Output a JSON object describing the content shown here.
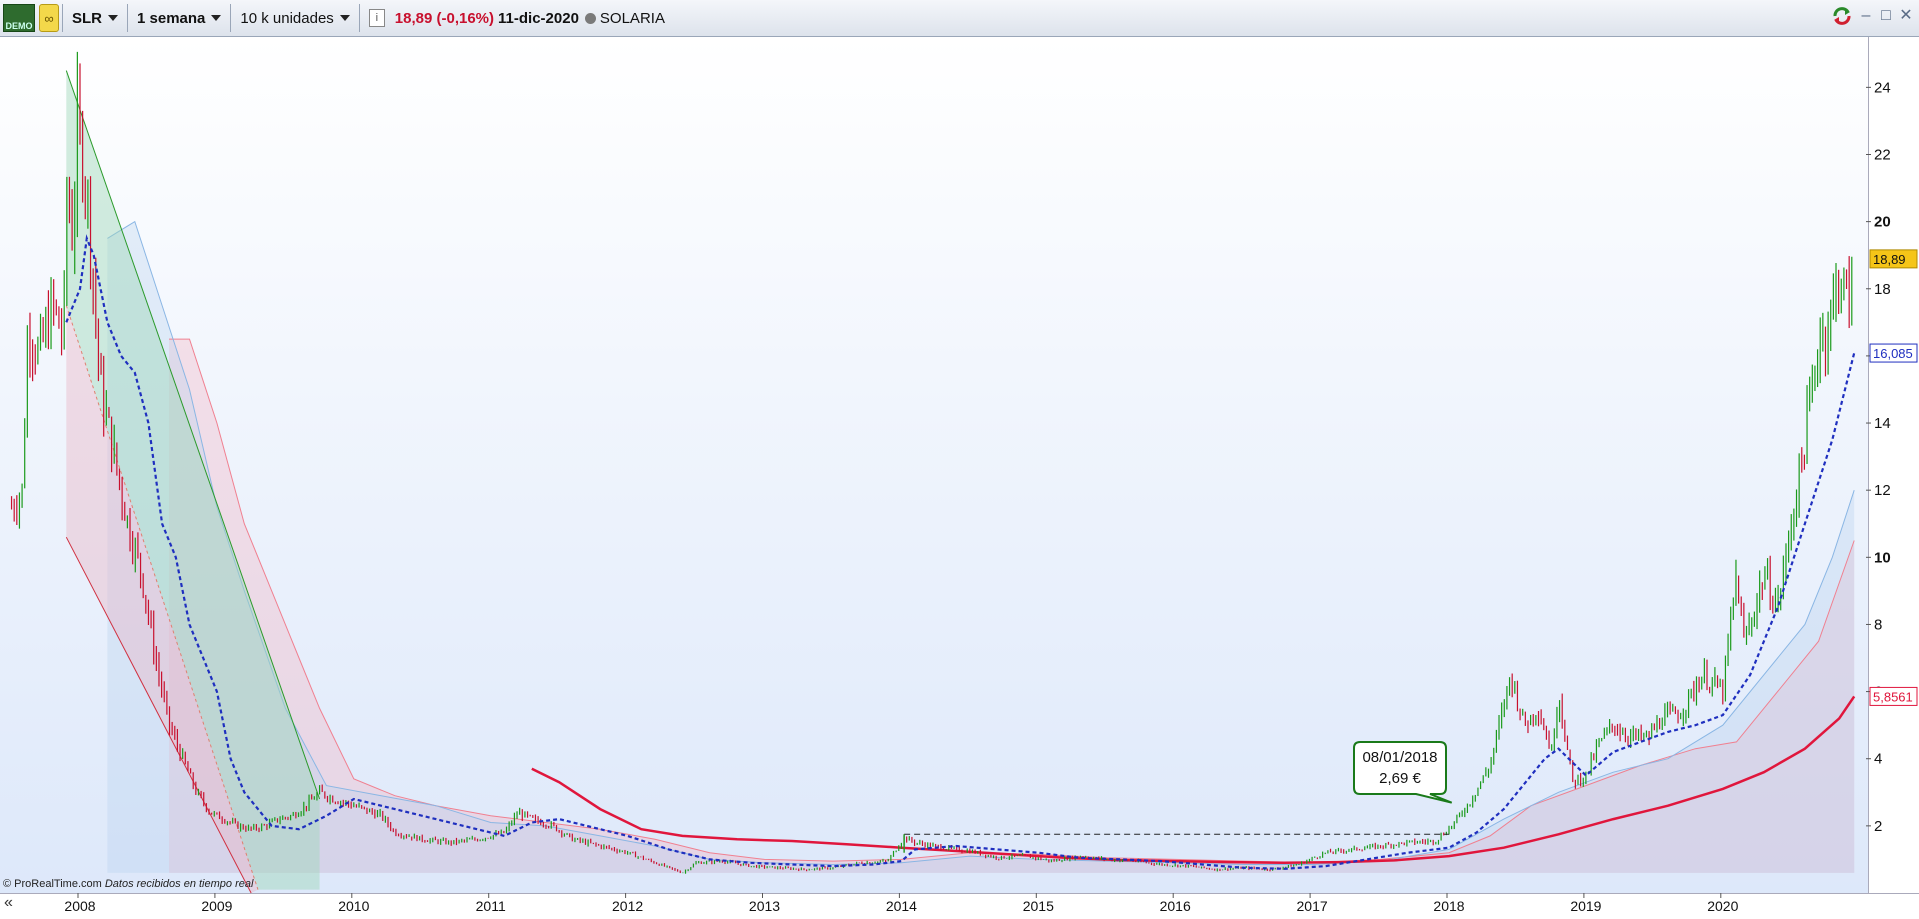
{
  "toolbar": {
    "demo_label": "DEMO",
    "ticker": "SLR",
    "timeframe": "1 semana",
    "units": "10 k unidades",
    "price_change": "18,89 (-0,16%)",
    "date": "11-dic-2020",
    "instrument_name": "SOLARIA"
  },
  "footer": {
    "copyright": "© ProRealTime.com",
    "realtime": "Datos recibidos en tiempo real",
    "nav_arrows": "«"
  },
  "annotation": {
    "date": "08/01/2018",
    "price": "2,69 €"
  },
  "colors": {
    "bull": "#1a9a1a",
    "bear": "#c8102e",
    "ma_dashed": "#1f2fbf",
    "ma_long": "#e0163c",
    "cloud_red": "#f4b3c0",
    "cloud_blue": "#b6d2ef"
  },
  "chart_data": {
    "type": "line",
    "title": "",
    "xlabel": "",
    "ylabel": "",
    "x_ticks": [
      "2008",
      "2009",
      "2010",
      "2011",
      "2012",
      "2013",
      "2014",
      "2015",
      "2016",
      "2017",
      "2018",
      "2019",
      "2020"
    ],
    "y_ticks": [
      2,
      4,
      6,
      8,
      10,
      12,
      14,
      16,
      18,
      20,
      22,
      24
    ],
    "ylim": [
      0,
      25.5
    ],
    "xlim": [
      2007.5,
      2020.98
    ],
    "price_labels": [
      {
        "value": 18.89,
        "text": "18,89",
        "color": "#f5c518"
      },
      {
        "value": 16.085,
        "text": "16,085",
        "color": "#1f2fbf"
      },
      {
        "value": 5.8561,
        "text": "5,8561",
        "color": "#e0163c"
      }
    ],
    "series": [
      {
        "kind": "price_close",
        "x": [
          2007.5,
          2007.58,
          2007.62,
          2007.7,
          2007.8,
          2007.88,
          2007.9,
          2007.95,
          2007.98,
          2008.05,
          2008.15,
          2008.25,
          2008.35,
          2008.45,
          2008.55,
          2008.65,
          2008.75,
          2008.85,
          2008.95,
          2009.05,
          2009.15,
          2009.25,
          2009.35,
          2009.45,
          2009.55,
          2009.65,
          2009.75,
          2009.85,
          2010.0,
          2010.2,
          2010.3,
          2010.5,
          2010.7,
          2010.9,
          2011.1,
          2011.2,
          2011.3,
          2011.45,
          2011.6,
          2011.8,
          2012.0,
          2012.2,
          2012.4,
          2012.5,
          2012.7,
          2012.9,
          2013.1,
          2013.3,
          2013.5,
          2013.7,
          2013.9,
          2014.02,
          2014.1,
          2014.3,
          2014.5,
          2014.7,
          2014.9,
          2015.1,
          2015.3,
          2015.5,
          2015.7,
          2015.9,
          2016.1,
          2016.3,
          2016.5,
          2016.7,
          2016.9,
          2017.1,
          2017.3,
          2017.5,
          2017.7,
          2017.9,
          2018.02,
          2018.15,
          2018.3,
          2018.45,
          2018.55,
          2018.65,
          2018.75,
          2018.8,
          2018.9,
          2019.0,
          2019.1,
          2019.2,
          2019.3,
          2019.45,
          2019.55,
          2019.7,
          2019.85,
          2020.0,
          2020.1,
          2020.15,
          2020.2,
          2020.3,
          2020.4,
          2020.5,
          2020.6,
          2020.7,
          2020.78,
          2020.85,
          2020.92,
          2020.96
        ],
        "values": [
          11.5,
          12.0,
          17.0,
          16.0,
          17.5,
          16.5,
          21.0,
          19.5,
          23.0,
          21.0,
          15.0,
          13.0,
          11.0,
          9.5,
          7.0,
          5.0,
          4.0,
          3.0,
          2.4,
          2.2,
          2.0,
          1.9,
          2.0,
          2.2,
          2.3,
          2.6,
          3.0,
          2.8,
          2.6,
          2.3,
          1.8,
          1.6,
          1.5,
          1.6,
          1.8,
          2.4,
          2.2,
          2.0,
          1.6,
          1.4,
          1.2,
          0.9,
          0.6,
          0.9,
          0.95,
          0.8,
          0.75,
          0.7,
          0.75,
          0.9,
          0.95,
          1.65,
          1.5,
          1.35,
          1.25,
          1.05,
          1.1,
          0.95,
          1.1,
          1.0,
          0.95,
          0.85,
          0.8,
          0.7,
          0.75,
          0.7,
          0.85,
          1.2,
          1.3,
          1.4,
          1.5,
          1.55,
          2.0,
          2.7,
          3.8,
          6.5,
          5.0,
          5.5,
          4.2,
          6.0,
          3.3,
          3.5,
          4.5,
          5.0,
          4.7,
          4.6,
          5.2,
          5.4,
          6.5,
          6.0,
          9.5,
          7.5,
          8.0,
          9.5,
          8.5,
          11.0,
          13.5,
          16.5,
          17.0,
          18.5,
          17.5,
          18.89
        ]
      },
      {
        "kind": "ma_dashed",
        "x": [
          2007.9,
          2008.0,
          2008.05,
          2008.1,
          2008.2,
          2008.3,
          2008.4,
          2008.5,
          2008.6,
          2008.7,
          2008.8,
          2008.9,
          2009.0,
          2009.1,
          2009.2,
          2009.4,
          2009.6,
          2009.8,
          2010.0,
          2010.3,
          2010.6,
          2010.9,
          2011.1,
          2011.3,
          2011.5,
          2011.8,
          2012.0,
          2012.3,
          2012.6,
          2012.9,
          2013.2,
          2013.5,
          2013.8,
          2014.0,
          2014.1,
          2014.4,
          2014.7,
          2015.0,
          2015.3,
          2015.6,
          2015.9,
          2016.2,
          2016.5,
          2016.8,
          2017.1,
          2017.4,
          2017.7,
          2018.0,
          2018.2,
          2018.4,
          2018.6,
          2018.7,
          2018.8,
          2019.0,
          2019.2,
          2019.4,
          2019.6,
          2019.8,
          2020.0,
          2020.2,
          2020.4,
          2020.6,
          2020.8,
          2020.96
        ],
        "values": [
          17.0,
          18.0,
          19.5,
          19.0,
          17.0,
          16.0,
          15.5,
          14.0,
          11.0,
          10.0,
          8.0,
          7.0,
          6.0,
          4.0,
          3.0,
          2.0,
          1.9,
          2.3,
          2.8,
          2.5,
          2.2,
          1.9,
          1.7,
          2.1,
          2.2,
          1.9,
          1.7,
          1.3,
          1.0,
          0.9,
          0.85,
          0.8,
          0.85,
          0.95,
          1.3,
          1.4,
          1.3,
          1.2,
          1.05,
          1.0,
          0.95,
          0.85,
          0.75,
          0.72,
          0.8,
          1.0,
          1.2,
          1.35,
          1.8,
          2.5,
          3.5,
          4.0,
          4.3,
          3.5,
          4.2,
          4.5,
          4.8,
          5.0,
          5.3,
          6.5,
          8.5,
          11.0,
          13.5,
          16.085
        ]
      },
      {
        "kind": "ma_long",
        "x": [
          2011.3,
          2011.5,
          2011.8,
          2012.1,
          2012.4,
          2012.8,
          2013.2,
          2013.6,
          2014.0,
          2014.4,
          2014.8,
          2015.2,
          2015.6,
          2016.0,
          2016.4,
          2016.8,
          2017.2,
          2017.6,
          2018.0,
          2018.4,
          2018.8,
          2019.2,
          2019.6,
          2020.0,
          2020.3,
          2020.6,
          2020.85,
          2020.96
        ],
        "values": [
          3.7,
          3.3,
          2.5,
          1.9,
          1.7,
          1.6,
          1.55,
          1.45,
          1.35,
          1.25,
          1.15,
          1.05,
          0.98,
          0.95,
          0.92,
          0.9,
          0.92,
          0.97,
          1.1,
          1.35,
          1.75,
          2.2,
          2.6,
          3.1,
          3.6,
          4.3,
          5.2,
          5.8561
        ]
      },
      {
        "kind": "cloud_upper_red",
        "x": [
          2008.65,
          2008.8,
          2009.0,
          2009.2,
          2009.4,
          2009.6,
          2009.75,
          2010.0,
          2010.3,
          2010.6,
          2011.0,
          2011.4,
          2011.8,
          2012.2,
          2012.6,
          2013.0,
          2013.5,
          2014.0,
          2014.5,
          2015.0,
          2015.5,
          2016.0,
          2016.5,
          2017.0,
          2017.5,
          2018.0,
          2018.3,
          2018.6,
          2019.0,
          2019.4,
          2019.8,
          2020.1,
          2020.4,
          2020.7,
          2020.96
        ],
        "values": [
          16.5,
          16.5,
          14.0,
          11.0,
          9.0,
          7.0,
          5.5,
          3.4,
          2.9,
          2.6,
          2.3,
          2.1,
          1.9,
          1.6,
          1.2,
          1.0,
          0.95,
          1.0,
          1.2,
          1.15,
          1.05,
          1.0,
          0.95,
          0.9,
          1.0,
          1.2,
          1.7,
          2.6,
          3.2,
          3.8,
          4.3,
          4.5,
          6.0,
          7.5,
          10.5
        ]
      },
      {
        "kind": "cloud_lower_blue",
        "x": [
          2008.2,
          2008.4,
          2008.6,
          2008.8,
          2009.0,
          2009.2,
          2009.5,
          2009.8,
          2010.2,
          2010.6,
          2011.0,
          2011.4,
          2011.8,
          2012.2,
          2012.6,
          2013.0,
          2013.5,
          2014.0,
          2014.5,
          2015.0,
          2015.5,
          2016.0,
          2016.5,
          2017.0,
          2017.5,
          2018.0,
          2018.4,
          2018.8,
          2019.2,
          2019.6,
          2020.0,
          2020.3,
          2020.6,
          2020.8,
          2020.96
        ],
        "values": [
          19.5,
          20.0,
          17.5,
          15.0,
          11.5,
          9.0,
          5.5,
          3.2,
          2.9,
          2.6,
          2.1,
          2.0,
          1.7,
          1.4,
          1.0,
          0.9,
          0.85,
          0.9,
          1.1,
          1.0,
          0.95,
          0.9,
          0.85,
          0.85,
          0.95,
          1.3,
          2.2,
          3.0,
          3.6,
          4.0,
          5.0,
          6.5,
          8.0,
          10.0,
          12.0
        ]
      }
    ],
    "annotations": [
      {
        "type": "trendline",
        "color": "green",
        "from": [
          2007.9,
          24.5
        ],
        "to": [
          2009.75,
          2.8
        ]
      },
      {
        "type": "trendline",
        "color": "red",
        "from": [
          2007.9,
          10.6
        ],
        "to": [
          2009.25,
          0.0
        ]
      },
      {
        "type": "dashed_level",
        "value": 1.75,
        "from": 2014.02,
        "to": 2018.0
      },
      {
        "type": "callout",
        "x": 2018.02,
        "y": 2.69
      }
    ]
  }
}
